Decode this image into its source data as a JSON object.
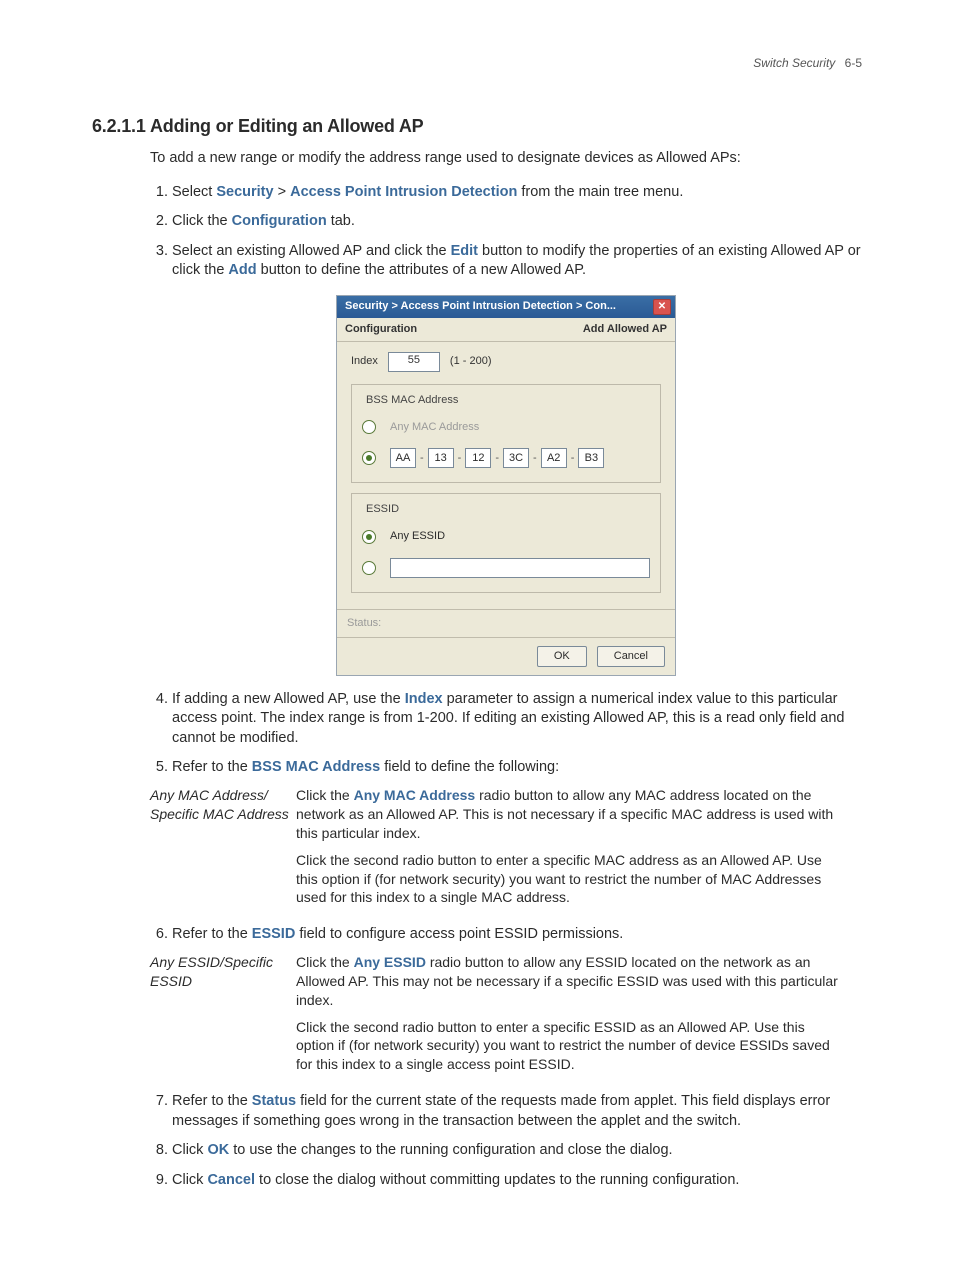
{
  "header": {
    "running_title": "Switch Security",
    "page_number": "6-5"
  },
  "section": {
    "number": "6.2.1.1",
    "title": "Adding or Editing an Allowed AP",
    "intro": "To add a new range or modify the address range used to designate devices as Allowed APs:"
  },
  "steps": {
    "s1_a": "Select ",
    "s1_b": "Security",
    "s1_c": " > ",
    "s1_d": "Access Point Intrusion Detection",
    "s1_e": " from the main tree menu.",
    "s2_a": "Click the ",
    "s2_b": "Configuration",
    "s2_c": " tab.",
    "s3_a": "Select an existing Allowed AP and click the ",
    "s3_b": "Edit",
    "s3_c": " button to modify the properties of an existing Allowed AP or click the ",
    "s3_d": "Add",
    "s3_e": " button to define the attributes of a new Allowed AP.",
    "s4_a": "If adding a new Allowed AP, use the ",
    "s4_b": "Index",
    "s4_c": " parameter to assign a numerical index value to this particular access point. The index range is from 1-200. If editing an existing Allowed AP, this is a read only field and cannot be modified.",
    "s5_a": "Refer to the ",
    "s5_b": "BSS MAC Address",
    "s5_c": " field to define the following:",
    "s6_a": "Refer to the ",
    "s6_b": "ESSID",
    "s6_c": " field to configure access point ESSID permissions.",
    "s7_a": "Refer to the ",
    "s7_b": "Status",
    "s7_c": " field for the current state of the requests made from applet. This field displays error messages if something goes wrong in the transaction between the applet and the switch.",
    "s8_a": "Click ",
    "s8_b": "OK",
    "s8_c": " to use the changes to the running configuration and close the dialog.",
    "s9_a": "Click ",
    "s9_b": "Cancel",
    "s9_c": " to close the dialog without committing updates to the running configuration."
  },
  "def_mac": {
    "term": "Any MAC Address/ Specific MAC Address",
    "p1_a": "Click the ",
    "p1_b": "Any MAC Address",
    "p1_c": " radio button to allow any MAC address located on the network as an Allowed AP. This is not necessary if a specific MAC address is used with this particular index.",
    "p2": "Click the second radio button to enter a specific MAC address as an Allowed AP. Use this option if (for network security) you want to restrict the number of MAC Addresses used for this index to a single MAC address."
  },
  "def_essid": {
    "term": "Any ESSID/Specific ESSID",
    "p1_a": "Click the ",
    "p1_b": "Any ESSID",
    "p1_c": " radio button to allow any ESSID located on the network as an Allowed AP. This may not be necessary if a specific ESSID was used with this particular index.",
    "p2": "Click the second radio button to enter a specific ESSID as an Allowed AP. Use this option if (for network security) you want to restrict the number of device ESSIDs saved for this index to a single access point ESSID."
  },
  "dialog": {
    "title": "Security > Access Point Intrusion Detection > Con...",
    "close": "✕",
    "sub_left": "Configuration",
    "sub_right": "Add Allowed AP",
    "index_label": "Index",
    "index_value": "55",
    "index_hint": "(1 - 200)",
    "mac_legend": "BSS MAC Address",
    "any_mac_label": "Any MAC Address",
    "mac": {
      "b1": "AA",
      "b2": "13",
      "b3": "12",
      "b4": "3C",
      "b5": "A2",
      "b6": "B3"
    },
    "mac_sep": "-",
    "essid_legend": "ESSID",
    "any_essid_label": "Any ESSID",
    "status_label": "Status:",
    "btn_ok": "OK",
    "btn_cancel": "Cancel"
  }
}
